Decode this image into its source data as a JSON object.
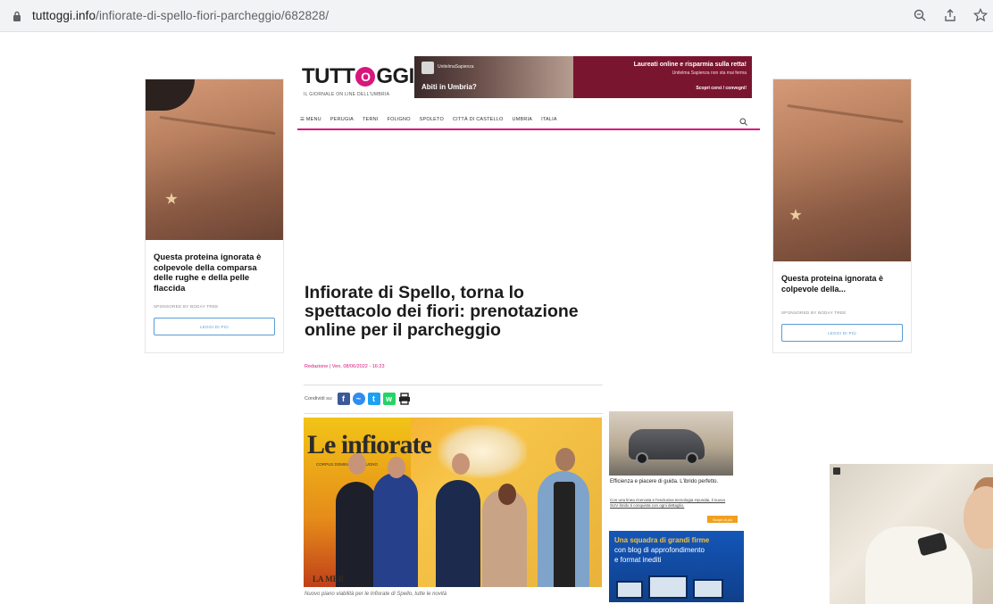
{
  "browser": {
    "url_host": "tuttoggi.info",
    "url_path": "/infiorate-di-spello-fiori-parcheggio/682828/",
    "icons": [
      "lock-icon",
      "zoom-icon",
      "share-icon",
      "star-icon"
    ]
  },
  "header": {
    "logo": "TUTT",
    "logo_o": "O",
    "logo_tail": "GGI",
    "tagline": "IL GIORNALE ON LINE DELL'UMBRIA",
    "banner": {
      "brand": "UnitelmaSapienza",
      "ask": "Abiti in Umbria?",
      "headline": "Laureati online e risparmia sulla retta!",
      "sub": "Unitelma Sapienza non sta mai ferma",
      "cta": "Scopri corsi / convegni!"
    }
  },
  "nav": {
    "items": [
      "☰ MENU",
      "PERUGIA",
      "TERNI",
      "FOLIGNO",
      "SPOLETO",
      "CITTÀ DI CASTELLO",
      "UMBRIA",
      "ITALIA"
    ]
  },
  "left_ad": {
    "text": "Questa proteina ignorata è colpevole della comparsa delle rughe e della pelle flaccida",
    "sponsor": "SPONSORED BY BODAY TREE",
    "button": "LEGGI DI PIÙ"
  },
  "right_ad": {
    "text": "Questa proteina ignorata è colpevole della...",
    "sponsor": "SPONSORED BY BODAY TREE",
    "button": "LEGGI DI PIÙ"
  },
  "article": {
    "title": "Infiorate di Spello, torna lo spettacolo dei fiori: prenotazione online per il parcheggio",
    "byline": "Redazione | Ven, 08/06/2022 - 16:23",
    "share_label": "Condividi su:",
    "photo_poster_title": "Le infiorate",
    "photo_poster_sub": "CORPUS DOMINI 18-19 GIUGNO",
    "photo_watermark": "LA MER",
    "caption": "Nuovo piano viabilità per le Infiorate di Spello, tutte le novità"
  },
  "sidebar_ads": {
    "car_title": "Efficienza e piacere di guida. L'ibrido perfetto.",
    "car_body": "Con una linea ricercata e l'esclusiva tecnologia Hyundai, il nuovo SUV ibrido ti conquista con ogni dettaglio.",
    "car_tag": "Scopri di più",
    "blue_line1": "Una squadra di grandi firme",
    "blue_line2": "con blog di approfondimento",
    "blue_line3": "e format inediti"
  }
}
